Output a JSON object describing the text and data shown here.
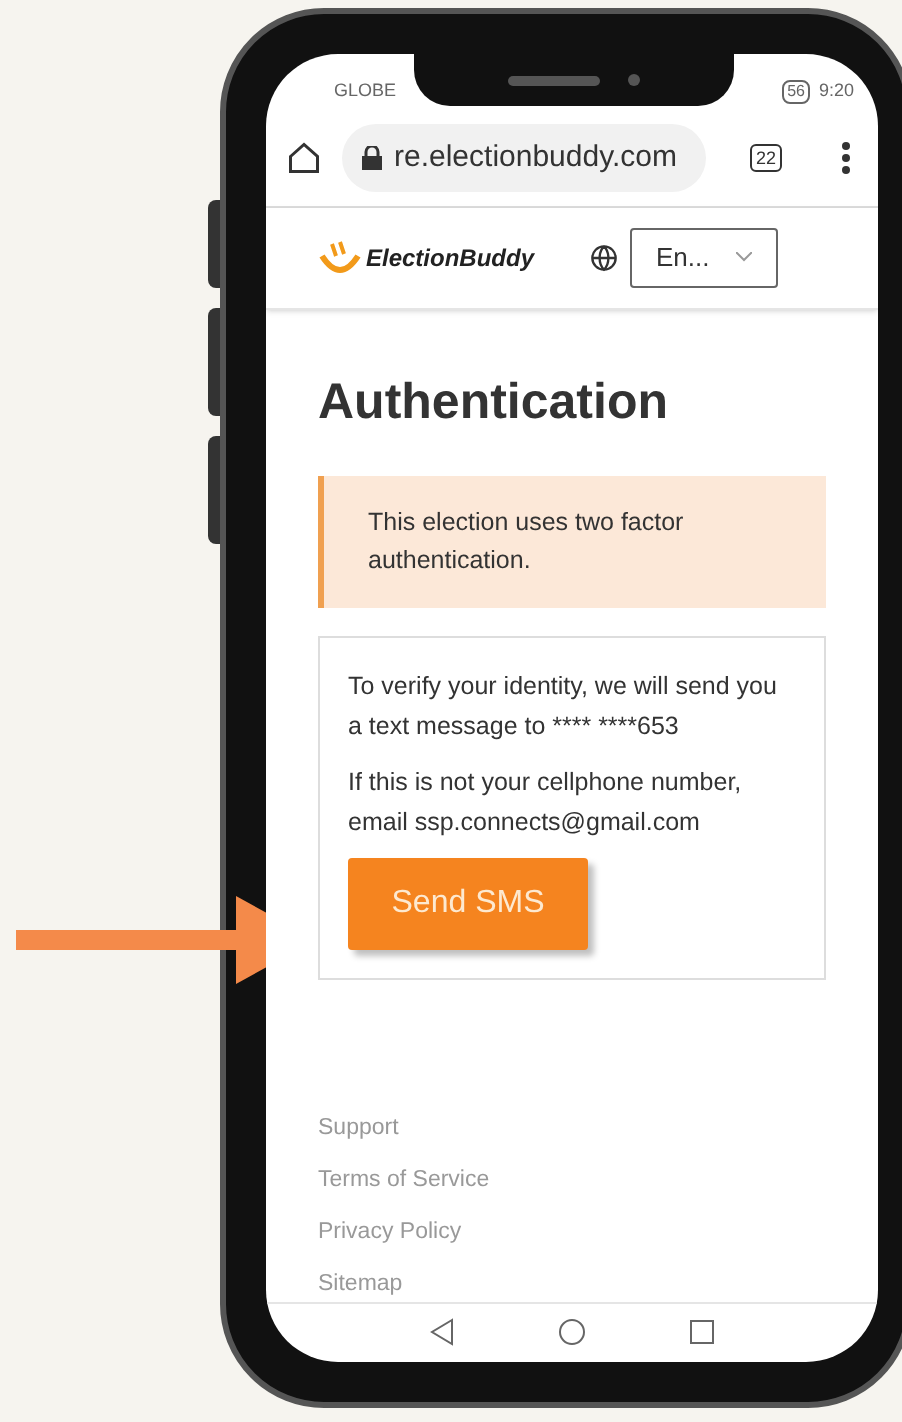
{
  "status_bar": {
    "carrier": "GLOBE",
    "battery": "56",
    "time": "9:20"
  },
  "browser": {
    "url": "re.electionbuddy.com",
    "tab_count": "22"
  },
  "header": {
    "logo": "ElectionBuddy",
    "language_select": {
      "value": "En..."
    }
  },
  "page": {
    "title": "Authentication",
    "alert": "This election uses two factor authentication.",
    "card": {
      "paragraphs": [
        "To verify your identity, we will send you a text message to **** ****653",
        "If this is not your cellphone number, email ssp.connects@gmail.com"
      ],
      "button": "Send SMS"
    }
  },
  "footer": {
    "links": [
      "Support",
      "Terms of Service",
      "Privacy Policy",
      "Sitemap"
    ]
  }
}
